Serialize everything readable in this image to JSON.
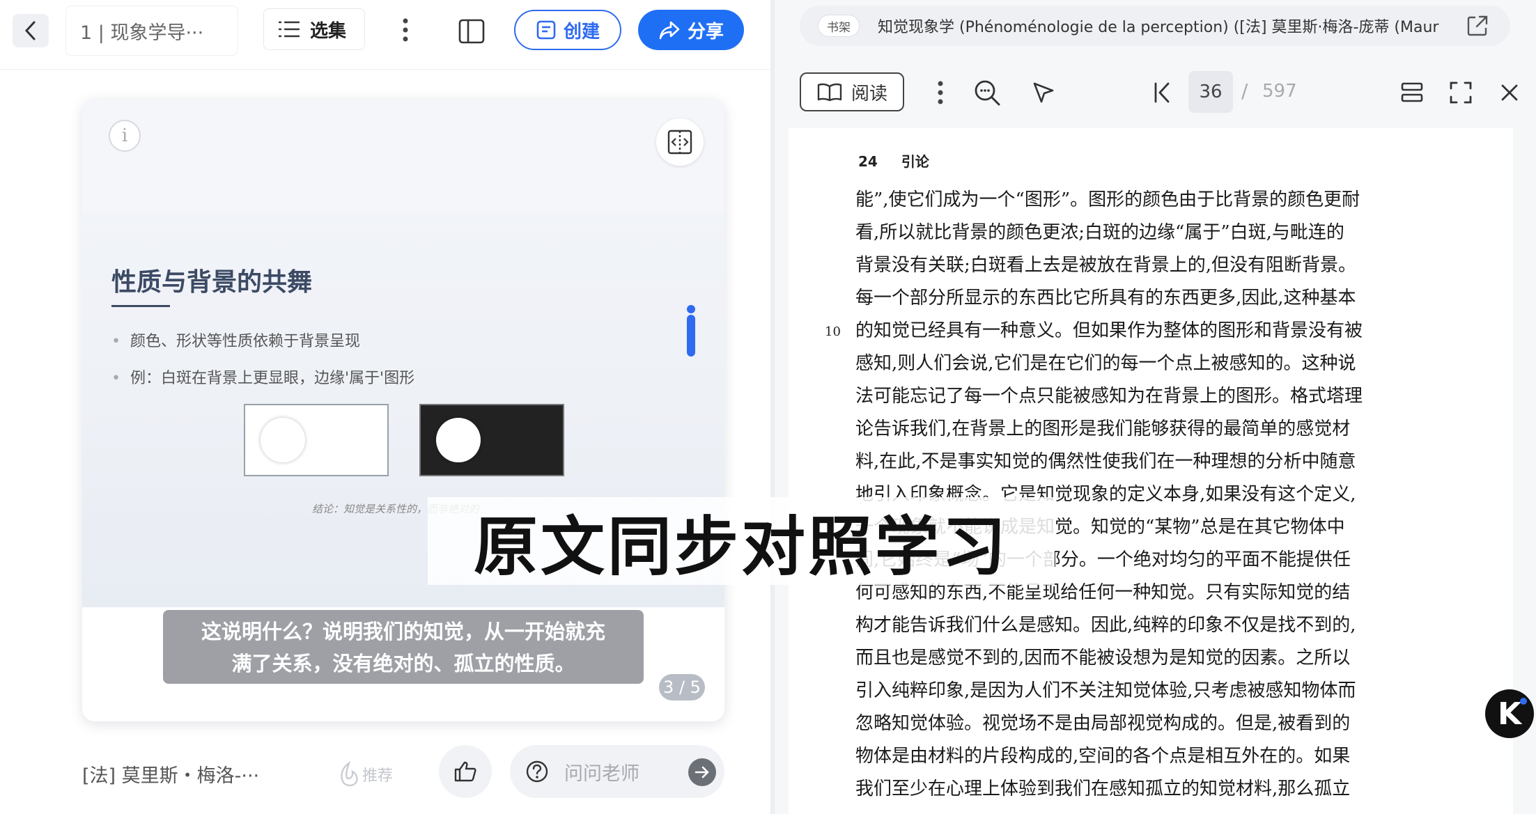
{
  "left": {
    "title": "1 | 现象学导···",
    "collection_label": "选集",
    "create_label": "创建",
    "share_label": "分享",
    "slide": {
      "title": "性质与背景的共舞",
      "bullets": [
        "颜色、形状等性质依赖于背景呈现",
        "例：白斑在背景上更显眼，边缘'属于'图形"
      ],
      "conclusion": "结论：知觉是关系性的，而非绝对的",
      "subtitle_line1": "这说明什么？说明我们的知觉，从一开始就充",
      "subtitle_line2": "满了关系，没有绝对的、孤立的性质。",
      "page_indicator": "3 / 5"
    },
    "bottom": {
      "author": "[法] 莫里斯・梅洛-···",
      "recommend_label": "推荐",
      "ask_placeholder": "问问老师"
    }
  },
  "right": {
    "shelf_label": "书架",
    "source_title": "知觉现象学 (Phénoménologie de la perception) ([法] 莫里斯·梅洛-庞蒂 (Maur",
    "read_label": "阅读",
    "current_page": "36",
    "page_sep": "/",
    "total_pages": "597",
    "page_number": "24",
    "page_section": "引论",
    "margin_line_number": "10",
    "lines": [
      "能”,使它们成为一个“图形”。图形的颜色由于比背景的颜色更耐",
      "看,所以就比背景的颜色更浓;白斑的边缘“属于”白斑,与毗连的",
      "背景没有关联;白斑看上去是被放在背景上的,但没有阻断背景。",
      "每一个部分所显示的东西比它所具有的东西更多,因此,这种基本",
      "的知觉已经具有一种意义。但如果作为整体的图形和背景没有被",
      "感知,则人们会说,它们是在它们的每一个点上被感知的。这种说",
      "法可能忘记了每一个点只能被感知为在背景上的图形。格式塔理",
      "论告诉我们,在背景上的图形是我们能够获得的最简单的感觉材",
      "料,在此,不是事实知觉的偶然性使我们在一种理想的分析中随意",
      "地引入印象概念。它是知觉现象的定义本身,如果没有这个定义,",
      "一个现象就不能说成是知觉。知觉的“某物”总是在其它物体中",
      "间,它始终是“场”的一个部分。一个绝对均匀的平面不能提供任",
      "何可感知的东西,不能呈现给任何一种知觉。只有实际知觉的结",
      "构才能告诉我们什么是感知。因此,纯粹的印象不仅是找不到的,",
      "而且也是感觉不到的,因而不能被设想为是知觉的因素。之所以",
      "引入纯粹印象,是因为人们不关注知觉体验,只考虑被感知物体而",
      "忽略知觉体验。视觉场不是由局部视觉构成的。但是,被看到的",
      "物体是由材料的片段构成的,空间的各个点是相互外在的。如果",
      "我们至少在心理上体验到我们在感知孤立的知觉材料,那么孤立"
    ]
  },
  "overlay_caption": "原文同步对照学习",
  "logo_letter": "K"
}
